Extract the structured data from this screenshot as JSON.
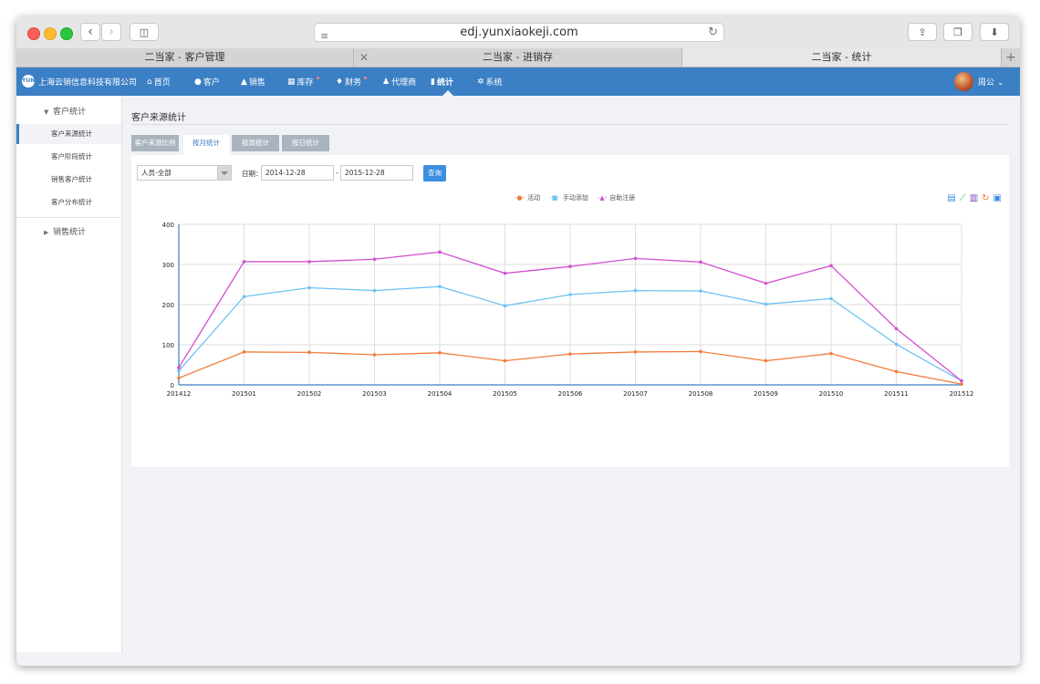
{
  "browser": {
    "url": "edj.yunxiaokeji.com",
    "tabs": [
      "二当家 - 客户管理",
      "二当家 - 进销存",
      "二当家 - 统计"
    ],
    "active_tab": 2
  },
  "app": {
    "company": "上海云销信息科技有限公司",
    "logo_text": "YUN",
    "menu": [
      {
        "label": "首页",
        "icon": "home-icon",
        "glyph": "⌂"
      },
      {
        "label": "客户",
        "icon": "user-icon",
        "glyph": "●"
      },
      {
        "label": "销售",
        "icon": "sales-chart-icon",
        "glyph": "▲"
      },
      {
        "label": "库存",
        "icon": "warehouse-icon",
        "glyph": "▦",
        "dot": true
      },
      {
        "label": "财务",
        "icon": "money-icon",
        "glyph": "♦",
        "dot": true
      },
      {
        "label": "代理商",
        "icon": "agents-icon",
        "glyph": "♟"
      },
      {
        "label": "统计",
        "icon": "stats-icon",
        "glyph": "▮",
        "active": true
      },
      {
        "label": "系统",
        "icon": "gear-icon",
        "glyph": "✲"
      }
    ],
    "user": "周公 ⌄"
  },
  "sidebar": {
    "groups": [
      {
        "label": "客户统计",
        "expanded": true,
        "items": [
          "客户来源统计",
          "客户阶段统计",
          "销售客户统计",
          "客户分布统计"
        ],
        "active_index": 0
      },
      {
        "label": "销售统计",
        "expanded": false,
        "items": []
      }
    ]
  },
  "main": {
    "title": "客户来源统计",
    "subtabs": [
      "客户来源比例",
      "按月统计",
      "按周统计",
      "按日统计"
    ],
    "active_subtab": 1,
    "filter": {
      "person": "人员-全部",
      "date_label": "日期：",
      "date_from": "2014-12-28",
      "date_sep": "-",
      "date_to": "2015-12-28",
      "query_button": "查询"
    },
    "toolbox": [
      "data-view-icon",
      "line-chart-icon",
      "bar-chart-icon",
      "refresh-icon",
      "save-icon"
    ]
  },
  "colors": {
    "primary": "#3b7fc4",
    "series_activity": "#f47b3a",
    "series_manual": "#6fc2f2",
    "series_self": "#d24fd0"
  },
  "chart_data": {
    "type": "line",
    "x": [
      "201412",
      "201501",
      "201502",
      "201503",
      "201504",
      "201505",
      "201506",
      "201507",
      "201508",
      "201509",
      "201510",
      "201511",
      "201512"
    ],
    "ylim": [
      0,
      400
    ],
    "yticks": [
      0,
      100,
      200,
      300,
      400
    ],
    "grid": true,
    "legend": "top-center",
    "series": [
      {
        "name": "活动",
        "color": "#f47b3a",
        "values": [
          17,
          82,
          81,
          75,
          80,
          60,
          77,
          82,
          83,
          60,
          78,
          33,
          2
        ]
      },
      {
        "name": "手动添加",
        "color": "#6fc2f2",
        "values": [
          35,
          220,
          242,
          235,
          245,
          197,
          225,
          235,
          234,
          201,
          215,
          101,
          10
        ]
      },
      {
        "name": "自助注册",
        "color": "#d24fd0",
        "values": [
          43,
          307,
          307,
          313,
          331,
          278,
          295,
          315,
          306,
          253,
          297,
          140,
          10
        ]
      }
    ]
  }
}
